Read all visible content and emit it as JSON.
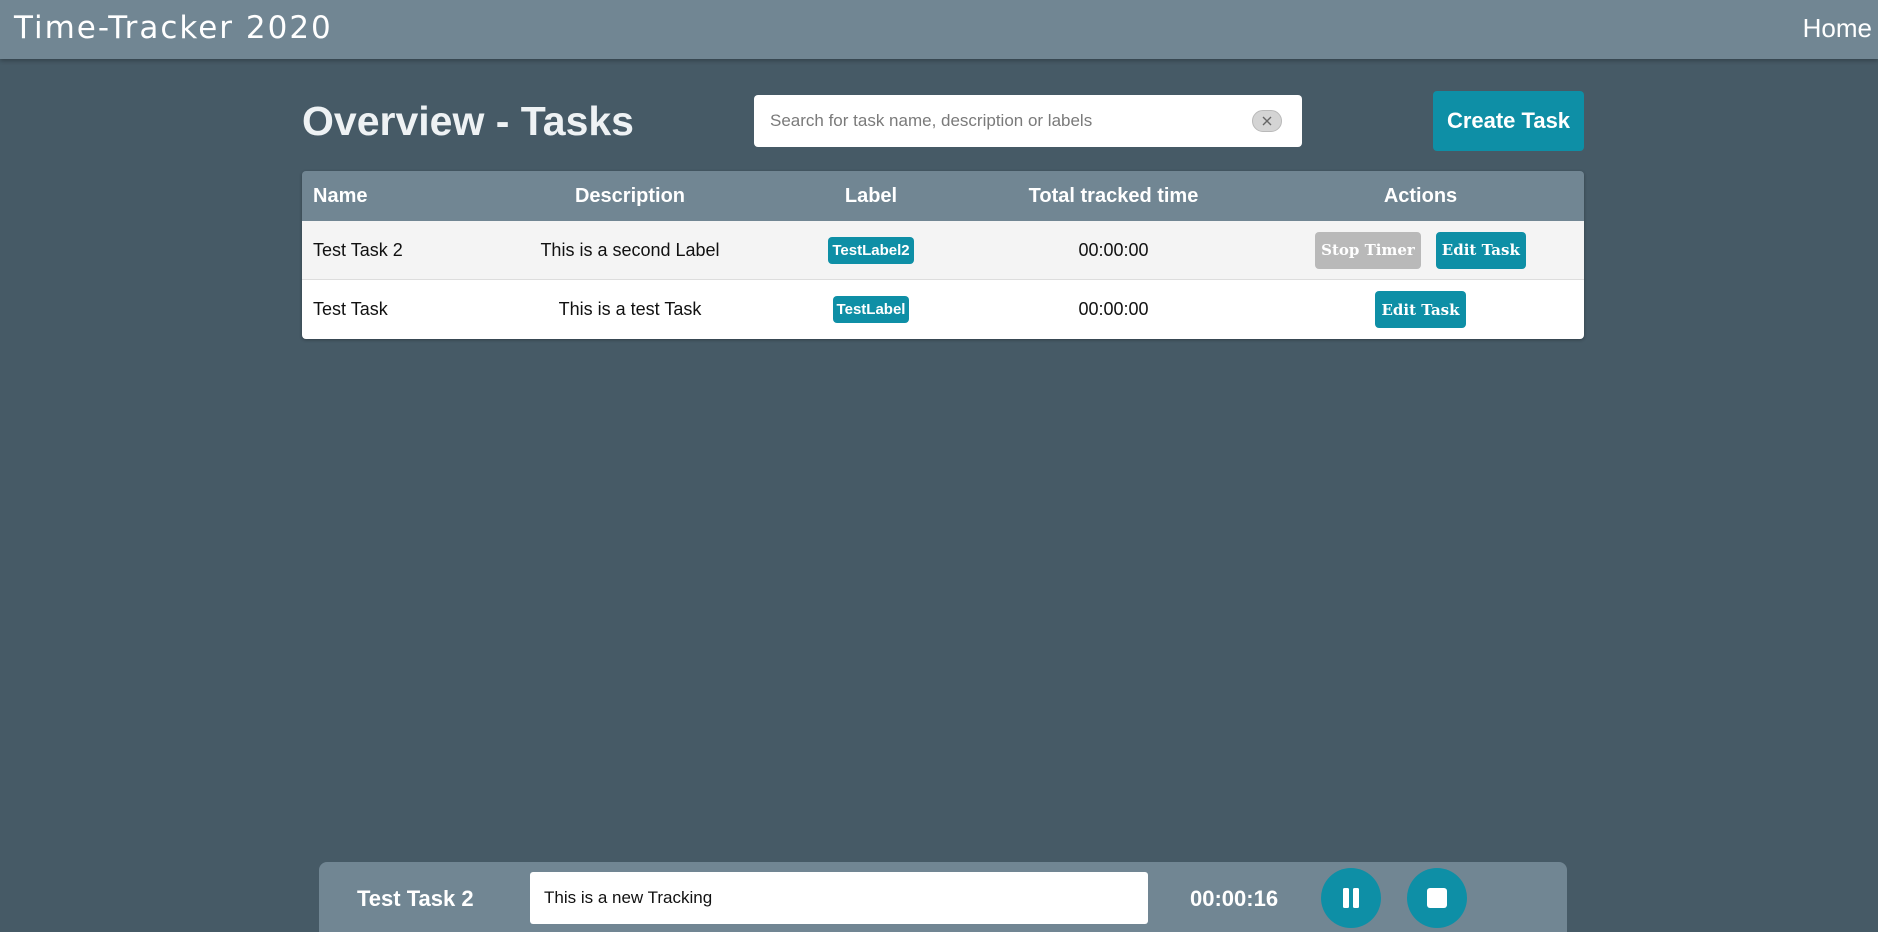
{
  "header": {
    "app_title": "Time-Tracker 2020",
    "nav_home": "Home"
  },
  "page": {
    "title": "Overview - Tasks"
  },
  "search": {
    "placeholder": "Search for task name, description or labels",
    "value": ""
  },
  "create_button": "Create Task",
  "table": {
    "columns": [
      "Name",
      "Description",
      "Label",
      "Total tracked time",
      "Actions"
    ],
    "rows": [
      {
        "name": "Test Task 2",
        "description": "This is a second Label",
        "label": "TestLabel2",
        "time": "00:00:00",
        "stop_label": "Stop Timer",
        "edit_label": "Edit Task"
      },
      {
        "name": "Test Task",
        "description": "This is a test Task",
        "label": "TestLabel",
        "time": "00:00:00",
        "edit_label": "Edit Task"
      }
    ]
  },
  "tracking": {
    "task_name": "Test Task 2",
    "description_value": "This is a new Tracking",
    "elapsed": "00:00:16"
  },
  "icons": {
    "clear": "close-icon",
    "pause": "pause-icon",
    "stop": "stop-icon"
  },
  "colors": {
    "background": "#465a66",
    "header": "#718693",
    "accent": "#0e8fa6",
    "disabled": "#b9b9b9"
  }
}
